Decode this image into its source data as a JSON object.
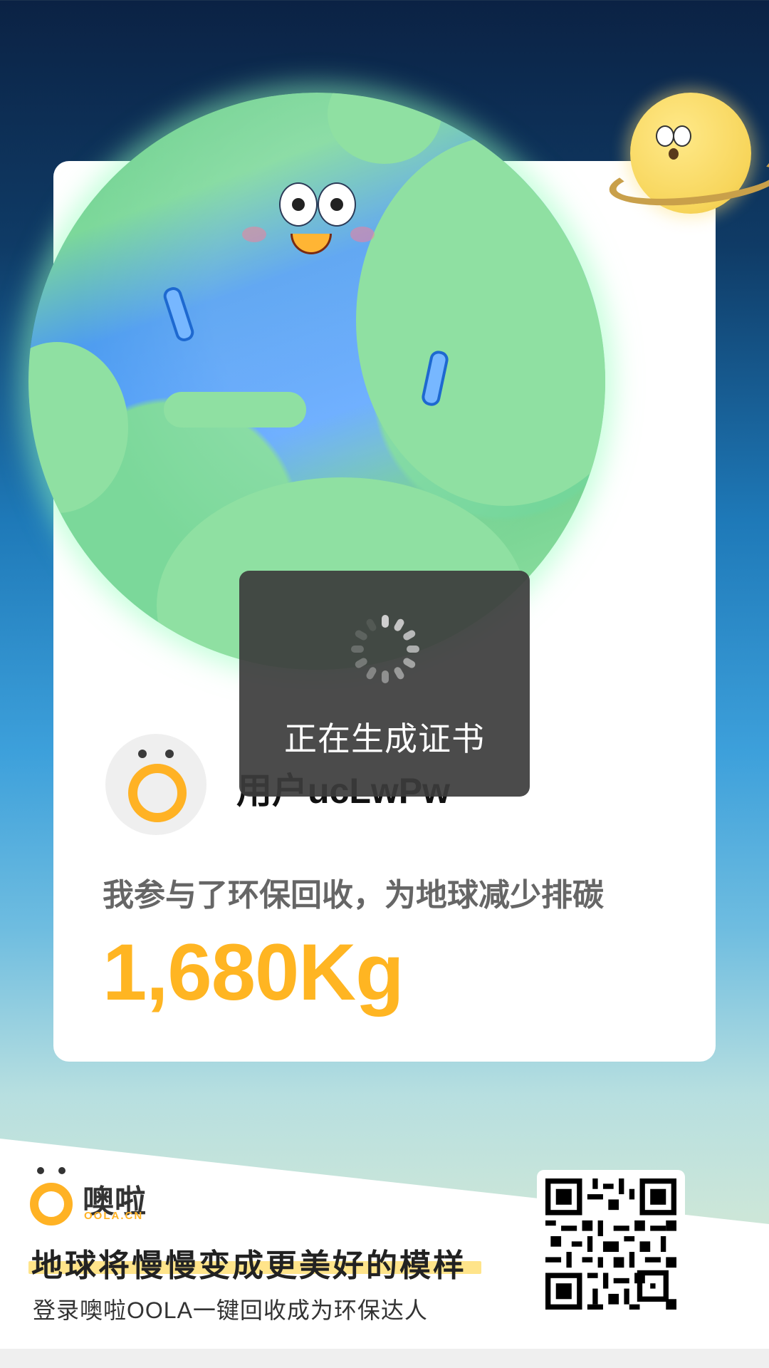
{
  "loading": {
    "text": "正在生成证书"
  },
  "user": {
    "name": "用户ucLwPw"
  },
  "stats": {
    "description": "我参与了环保回收，为地球减少排碳",
    "carbon_value": "1,680Kg"
  },
  "brand": {
    "name": "噢啦",
    "domain": "OOLA.CN",
    "slogan": "地球将慢慢变成更美好的模样",
    "subline": "登录噢啦OOLA一键回收成为环保达人"
  },
  "colors": {
    "accent": "#ffb522",
    "toast_bg": "#3c3c3c",
    "card_bg": "#ffffff"
  },
  "icons": {
    "avatar": "oola-logo-icon",
    "loader": "spinner-icon",
    "qr": "qr-code-icon"
  }
}
